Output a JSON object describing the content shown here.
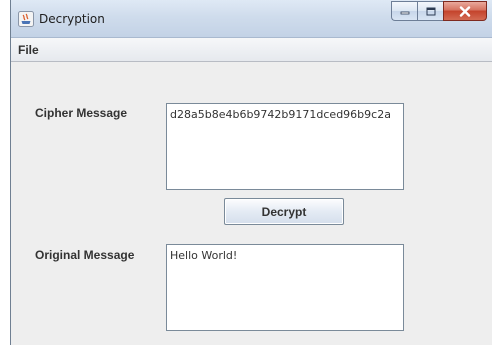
{
  "window": {
    "title": "Decryption",
    "controls": {
      "minimize_icon": "minimize-icon",
      "maximize_icon": "maximize-icon",
      "close_icon": "close-icon"
    }
  },
  "menubar": {
    "items": [
      {
        "label": "File"
      }
    ]
  },
  "form": {
    "cipher_label": "Cipher Message",
    "cipher_value": "d28a5b8e4b6b9742b9171dced96b9c2a",
    "decrypt_button": "Decrypt",
    "original_label": "Original Message",
    "original_value": "Hello World!"
  },
  "colors": {
    "window_background": "#eeeeee",
    "title_bar": "#cfdcec",
    "close_button": "#c4432c",
    "field_border": "#7a8a99"
  }
}
